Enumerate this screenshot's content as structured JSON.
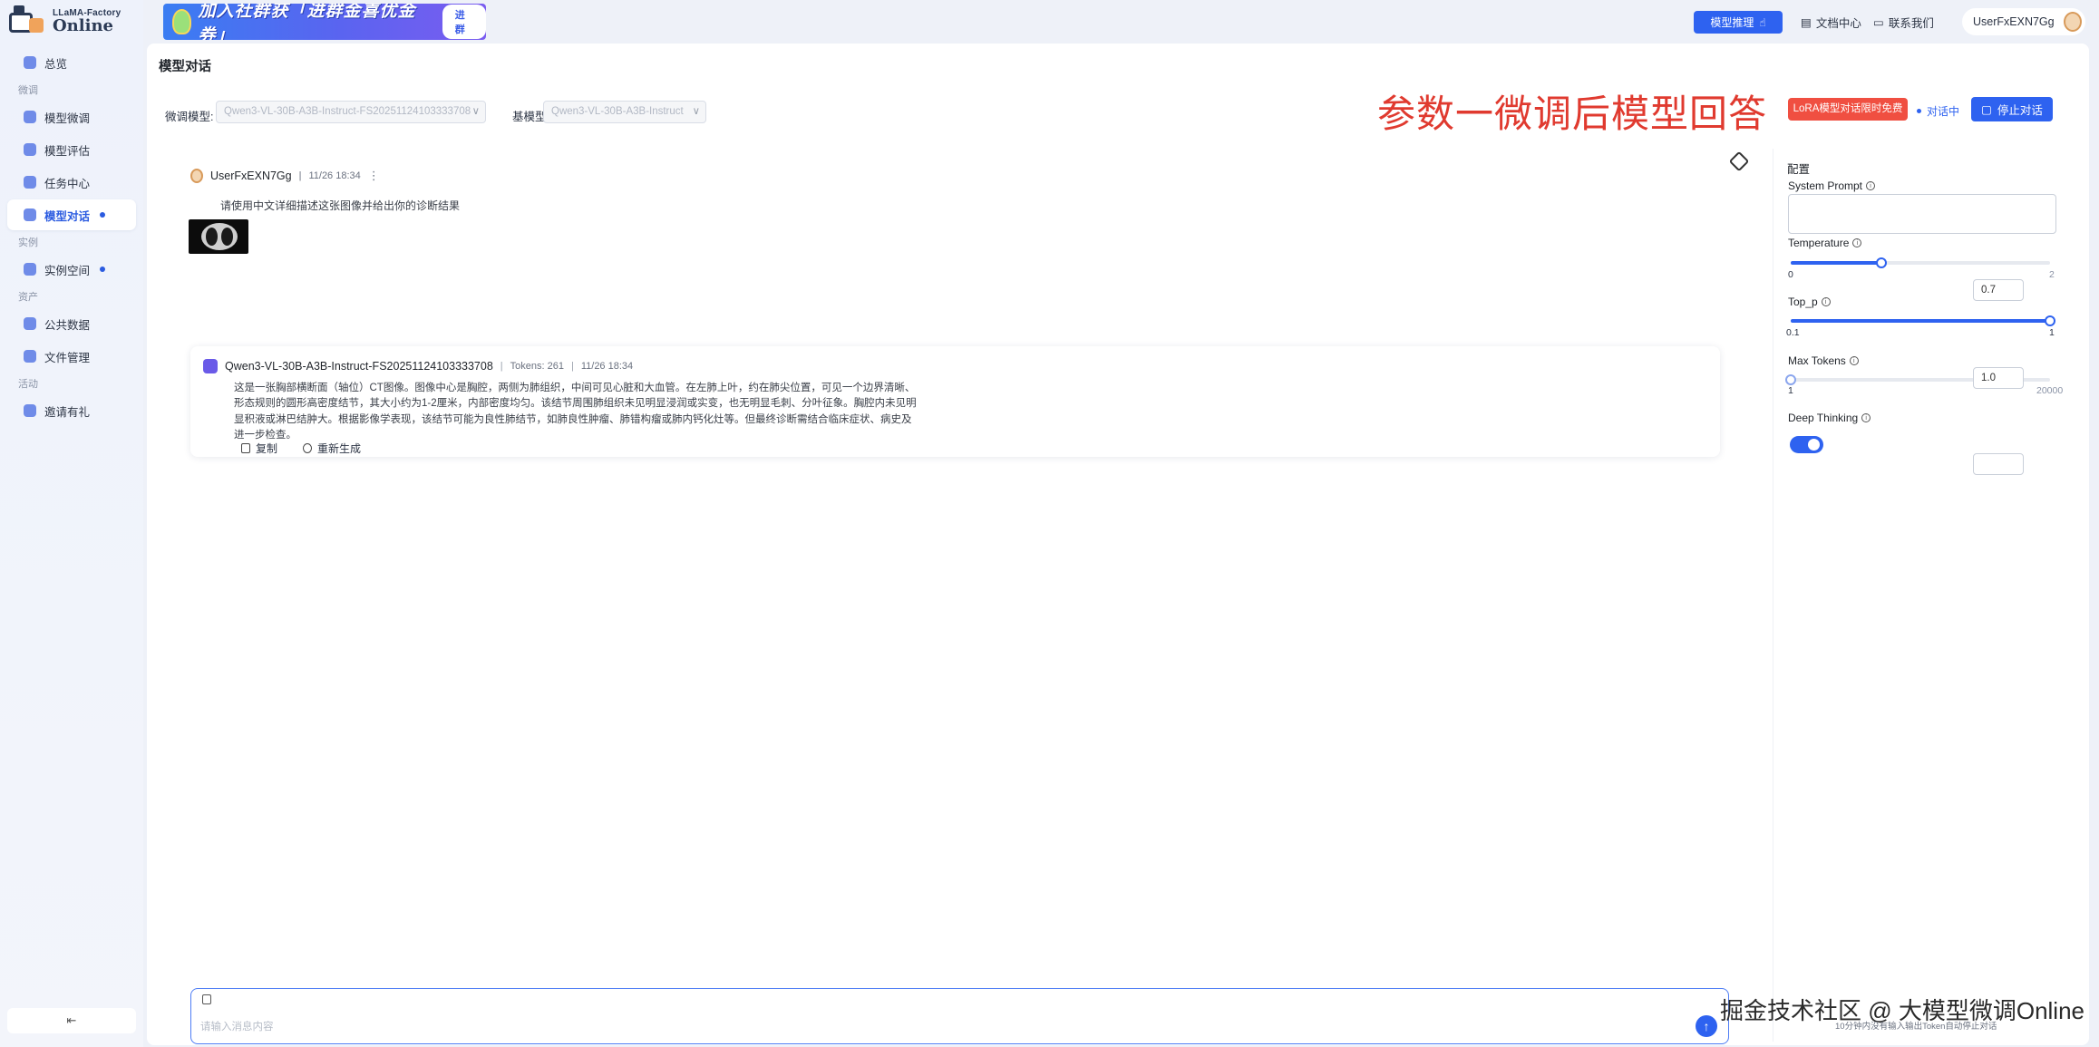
{
  "app": {
    "logo_line1": "LLaMA-Factory",
    "logo_line2": "Online",
    "page_title": "模型对话"
  },
  "sidebar": {
    "items": [
      {
        "type": "item",
        "label": "总览",
        "icon": "dashboard-icon"
      },
      {
        "type": "section",
        "label": "微调"
      },
      {
        "type": "item",
        "label": "模型微调",
        "icon": "finetune-icon"
      },
      {
        "type": "item",
        "label": "模型评估",
        "icon": "evaluate-icon"
      },
      {
        "type": "item",
        "label": "任务中心",
        "icon": "task-icon"
      },
      {
        "type": "item",
        "label": "模型对话",
        "icon": "chat-icon",
        "active": true,
        "dot": true
      },
      {
        "type": "section",
        "label": "实例"
      },
      {
        "type": "item",
        "label": "实例空间",
        "icon": "instance-icon",
        "dot": true
      },
      {
        "type": "section",
        "label": "资产"
      },
      {
        "type": "item",
        "label": "公共数据",
        "icon": "data-icon"
      },
      {
        "type": "item",
        "label": "文件管理",
        "icon": "folder-icon"
      },
      {
        "type": "section",
        "label": "活动"
      },
      {
        "type": "item",
        "label": "邀请有礼",
        "icon": "gift-icon"
      }
    ],
    "collapse_glyph": "⇤"
  },
  "topbar": {
    "banner_text": "加入社群获「进群金喜优金券」",
    "banner_button": "进群",
    "inference_button": "模型推理",
    "docs_link": "文档中心",
    "contact_link": "联系我们",
    "username": "UserFxEXN7Gg"
  },
  "toolbar": {
    "finetuned_label": "微调模型:",
    "finetuned_value": "Qwen3-VL-30B-A3B-Instruct-FS20251124103333708",
    "base_label": "基模型:",
    "base_value": "Qwen3-VL-30B-A3B-Instruct",
    "overlay_caption": "参数一微调后模型回答",
    "lora_badge": "LoRA模型对话限时免费",
    "status": "对话中",
    "stop_button": "停止对话"
  },
  "chat": {
    "user": {
      "name": "UserFxEXN7Gg",
      "time": "11/26 18:34",
      "more": "⋮",
      "text": "请使用中文详细描述这张图像并给出你的诊断结果"
    },
    "assistant": {
      "model": "Qwen3-VL-30B-A3B-Instruct-FS20251124103333708",
      "tokens": "Tokens: 261",
      "time": "11/26 18:34",
      "text": "这是一张胸部横断面（轴位）CT图像。图像中心是胸腔，两侧为肺组织，中间可见心脏和大血管。在左肺上叶，约在肺尖位置，可见一个边界清晰、形态规则的圆形高密度结节，其大小约为1-2厘米，内部密度均匀。该结节周围肺组织未见明显浸润或实变，也无明显毛刺、分叶征象。胸腔内未见明显积液或淋巴结肿大。根据影像学表现，该结节可能为良性肺结节，如肺良性肿瘤、肺错构瘤或肺内钙化灶等。但最终诊断需结合临床症状、病史及进一步检查。",
      "copy_label": "复制",
      "regen_label": "重新生成"
    },
    "input_placeholder": "请输入消息内容",
    "send_glyph": "↑"
  },
  "config": {
    "title": "配置",
    "system_prompt_label": "System Prompt",
    "temperature": {
      "label": "Temperature",
      "value": "0.7",
      "fraction": 0.35,
      "min": "0",
      "max": "2"
    },
    "top_p": {
      "label": "Top_p",
      "value": "1.0",
      "fraction": 1.0,
      "min": "0.1",
      "max": "1"
    },
    "max_tokens": {
      "label": "Max Tokens",
      "value": "",
      "fraction": 0.0,
      "min": "1",
      "max": "20000"
    },
    "deep_thinking": {
      "label": "Deep Thinking",
      "enabled": true
    }
  },
  "footer": {
    "watermark": "掘金技术社区 @ 大模型微调Online",
    "note": "10分钟内没有输入输出Token自动停止对话"
  },
  "colors": {
    "accent": "#2e62f0",
    "lora_badge": "#f04f41",
    "caption": "#e03a2f"
  }
}
